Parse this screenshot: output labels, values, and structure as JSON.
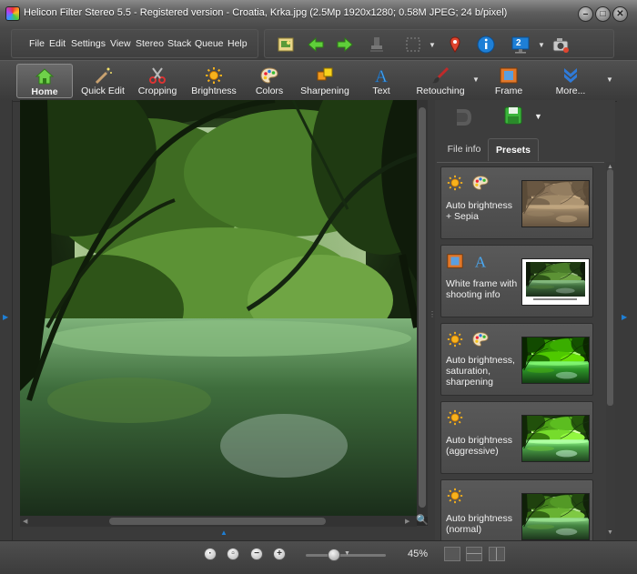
{
  "window": {
    "title": "Helicon Filter Stereo 5.5 - Registered version - Croatia, Krka.jpg (2.5Mp 1920x1280; 0.58M JPEG; 24 b/pixel)"
  },
  "menu": {
    "items": [
      "File",
      "Edit",
      "Settings",
      "View",
      "Stereo",
      "Stack",
      "Queue",
      "Help"
    ]
  },
  "toolbar": {
    "buttons": [
      "open-file-icon",
      "back-arrow-icon",
      "forward-arrow-icon",
      "stamp-icon",
      "selection-icon",
      "location-pin-icon",
      "info-icon",
      "stereo-view-icon",
      "camera-icon"
    ],
    "stereo_badge": "2"
  },
  "ribbon": {
    "tabs": [
      {
        "label": "Home",
        "icon": "home-icon"
      },
      {
        "label": "Quick Edit",
        "icon": "magic-wand-icon"
      },
      {
        "label": "Cropping",
        "icon": "scissors-icon"
      },
      {
        "label": "Brightness",
        "icon": "sun-icon"
      },
      {
        "label": "Colors",
        "icon": "palette-icon"
      },
      {
        "label": "Sharpening",
        "icon": "sharpening-icon"
      },
      {
        "label": "Text",
        "icon": "text-icon"
      },
      {
        "label": "Retouching",
        "icon": "brush-icon"
      },
      {
        "label": "Frame",
        "icon": "frame-icon"
      },
      {
        "label": "More...",
        "icon": "more-chevron-icon"
      }
    ],
    "active_tab": "Home"
  },
  "right_panel": {
    "tabs": [
      "File info",
      "Presets"
    ],
    "active_tab": "Presets",
    "presets": [
      {
        "label": "Auto brightness + Sepia",
        "icons": [
          "sun-icon",
          "palette-icon"
        ],
        "thumb_style": "sepia"
      },
      {
        "label": "White frame with shooting info",
        "icons": [
          "frame-icon",
          "text-icon"
        ],
        "thumb_style": "framed"
      },
      {
        "label": "Auto brightness, saturation, sharpening",
        "icons": [
          "sun-icon",
          "palette-icon"
        ],
        "thumb_style": "vivid"
      },
      {
        "label": "Auto brightness (aggressive)",
        "icons": [
          "sun-icon"
        ],
        "thumb_style": "bright"
      },
      {
        "label": "Auto brightness (normal)",
        "icons": [
          "sun-icon"
        ],
        "thumb_style": "normal"
      }
    ]
  },
  "statusbar": {
    "zoom_label": "45%",
    "zoom_fraction": 0.35,
    "buttons": [
      "fit-1to1-icon",
      "fit-window-icon",
      "zoom-out-icon",
      "zoom-in-icon"
    ],
    "layouts": [
      "single-layout-icon",
      "horizontal-split-icon",
      "vertical-split-icon"
    ]
  },
  "colors": {
    "accent_blue": "#1e7fd6",
    "panel_bg": "#3d3d3d"
  }
}
